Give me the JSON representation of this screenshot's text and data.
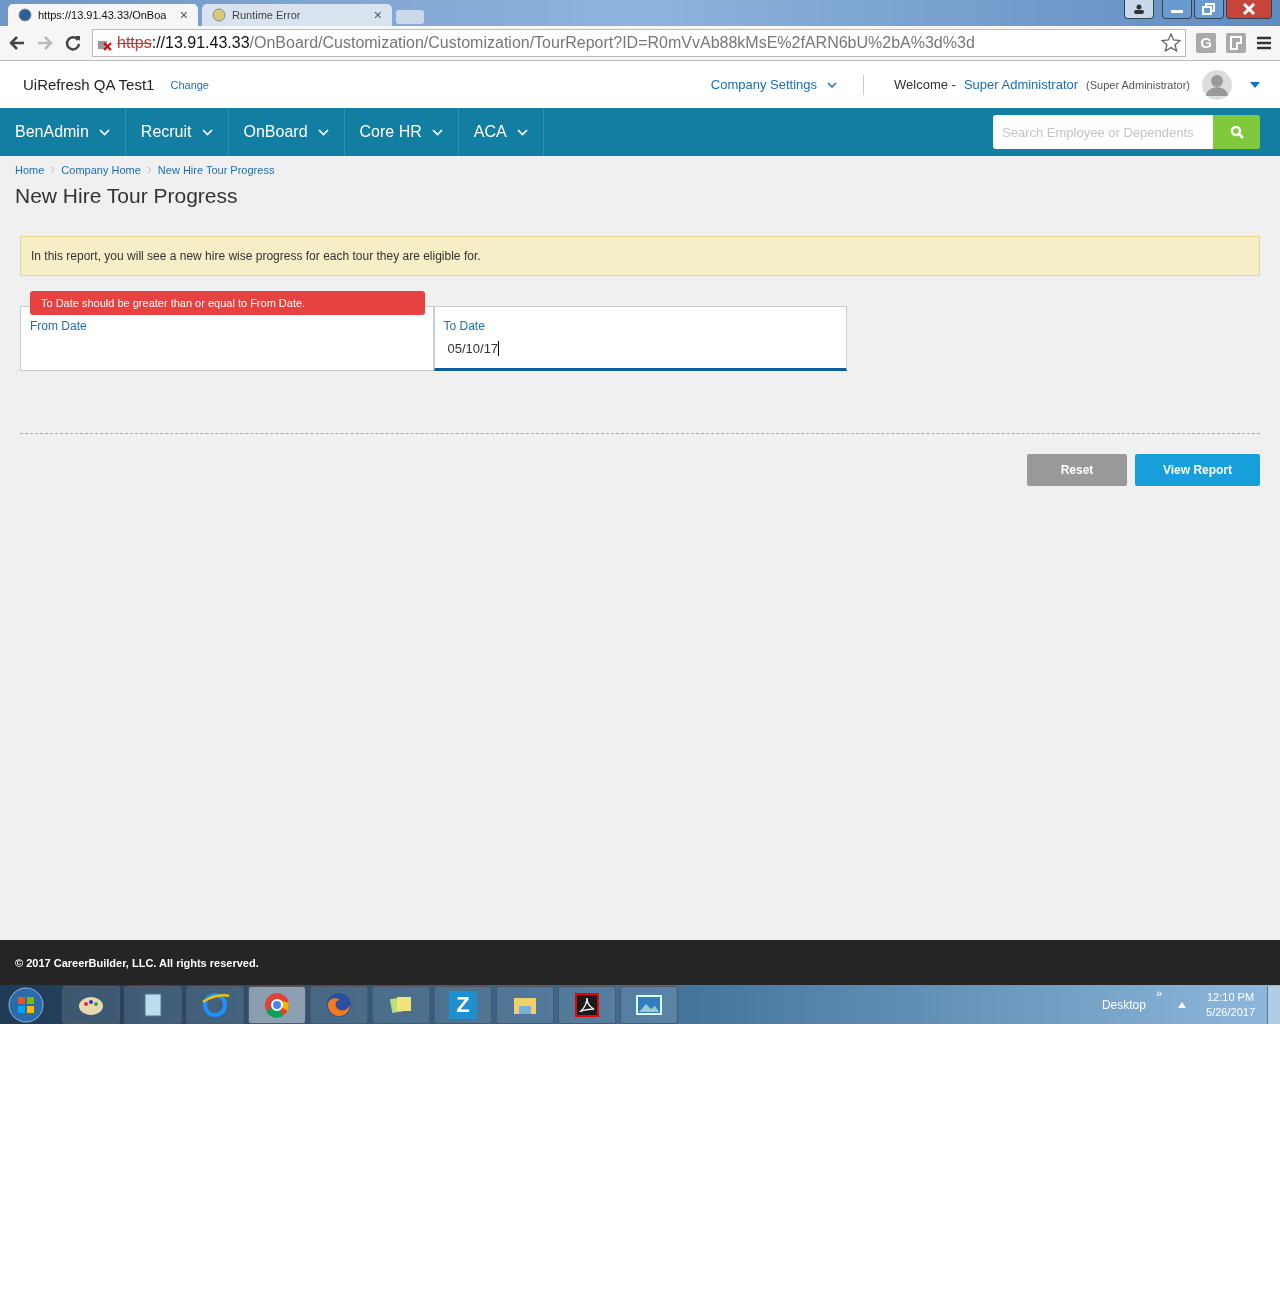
{
  "browser": {
    "tabs": [
      {
        "title": "https://13.91.43.33/OnBoa",
        "selected": true
      },
      {
        "title": "Runtime Error",
        "selected": false
      }
    ],
    "close_glyph": "×",
    "address": {
      "scheme": "https",
      "host": "://13.91.43.33",
      "path": "/OnBoard/Customization/Customization/TourReport?ID=R0mVvAb88kMsE%2fARN6bU%2bA%3d%3d"
    },
    "extension_letter": "G"
  },
  "header": {
    "company": "UiRefresh QA Test1",
    "change_link": "Change",
    "settings_menu": "Company Settings",
    "welcome": "Welcome -",
    "user": "Super Administrator",
    "role": "(Super Administrator)"
  },
  "nav": {
    "items": [
      "BenAdmin",
      "Recruit",
      "OnBoard",
      "Core HR",
      "ACA"
    ],
    "search": {
      "placeholder": "Search Employee or Dependents"
    }
  },
  "breadcrumb": [
    "Home",
    "Company Home",
    "New Hire Tour Progress"
  ],
  "page_title": "New Hire Tour Progress",
  "info": "In this report, you will see a new hire wise progress for each tour they are eligible for.",
  "fields": [
    {
      "label": "From Date",
      "focused": false
    },
    {
      "label": "To Date",
      "value": "05/10/17",
      "focused": true
    }
  ],
  "error": "To Date should be greater than or equal to From Date.",
  "buttons": [
    {
      "label": "Reset",
      "kind": "secondary"
    },
    {
      "label": "View Report",
      "kind": "primary"
    }
  ],
  "footer": "© 2017 CareerBuilder, LLC. All rights reserved.",
  "taskbar": {
    "apps": [
      {
        "kind": "paint"
      },
      {
        "kind": "notepad"
      },
      {
        "kind": "ie"
      },
      {
        "kind": "chrome",
        "selected": true
      },
      {
        "kind": "firefox"
      },
      {
        "kind": "notes"
      },
      {
        "kind": "letter",
        "letter": "Z"
      },
      {
        "kind": "folder"
      },
      {
        "kind": "pdf"
      },
      {
        "kind": "photo"
      }
    ],
    "desktop": "Desktop",
    "chevron": "»",
    "time": "12:10 PM",
    "date": "5/26/2017"
  }
}
